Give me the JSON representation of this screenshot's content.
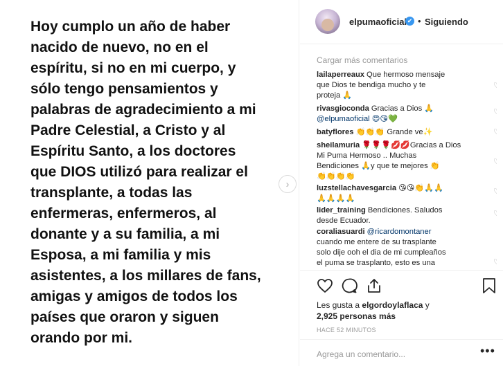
{
  "post": {
    "lines": [
      "Hoy cumplo un año de haber",
      "nacido de nuevo, no en el",
      "espíritu, si no en mi cuerpo, y",
      "sólo tengo pensamientos y",
      "palabras de agradecimiento a mi",
      "Padre Celestial, a Cristo y al",
      "Espíritu Santo, a los doctores",
      "que DIOS utilizó para realizar el",
      "transplante, a todas las",
      "enfermeras, enfermeros, al",
      "donante y a su familia, a mi",
      "Esposa, a mi familia y mis",
      "asistentes, a los millares de fans,",
      "amigas y amigos de todos los",
      "países que oraron y siguen",
      "orando por mi."
    ]
  },
  "header": {
    "username": "elpumaoficial",
    "verified_icon": "✔",
    "separator": "•",
    "follow_status": "Siguiendo"
  },
  "comments": {
    "load_more": "Cargar más comentarios",
    "items": [
      {
        "user": "lailaperreaux",
        "lines": [
          "Que hermoso mensaje",
          "que Dios te bendiga mucho y te",
          "proteja 🙏"
        ]
      },
      {
        "user": "rivasgioconda",
        "lines": [
          "Gracias a Dios 🙏",
          "@elpumaoficial 😍😘💚"
        ]
      },
      {
        "user": "batyflores",
        "lines": [
          "👏👏👏 Grande ve✨"
        ]
      },
      {
        "user": "sheilamuria",
        "lines": [
          "🌹🌹🌹💋💋Gracias a Dios",
          "Mi Puma Hermoso .. Muchas",
          "Bendiciones 🙏y que te mejores 👏",
          "👏👏👏👏"
        ]
      },
      {
        "user": "luzstellachavesgarcia",
        "lines": [
          "😘😘👏🙏🙏",
          "🙏🙏🙏🙏"
        ]
      },
      {
        "user": "lider_training",
        "lines": [
          "Bendiciones. Saludos",
          "desde Ecuador."
        ]
      },
      {
        "user": "coraliasuardi",
        "lines": [
          "@ricardomontaner",
          "cuando me entere de su trasplante",
          "solo dije ooh el dia de mi cumpleaños",
          "el puma se trasplanto, esto es una"
        ]
      }
    ]
  },
  "actions": {
    "like_icon": "heart-icon",
    "comment_icon": "comment-bubble-icon",
    "share_icon": "share-icon",
    "save_icon": "bookmark-icon"
  },
  "likes": {
    "prefix": "Les gusta a ",
    "user": "elgordoylaflaca",
    "middle": " y",
    "count": "2,925 personas más"
  },
  "timestamp": "HACE 52 MINUTOS",
  "comment_box": {
    "placeholder": "Agrega un comentario...",
    "more_label": "•••"
  }
}
